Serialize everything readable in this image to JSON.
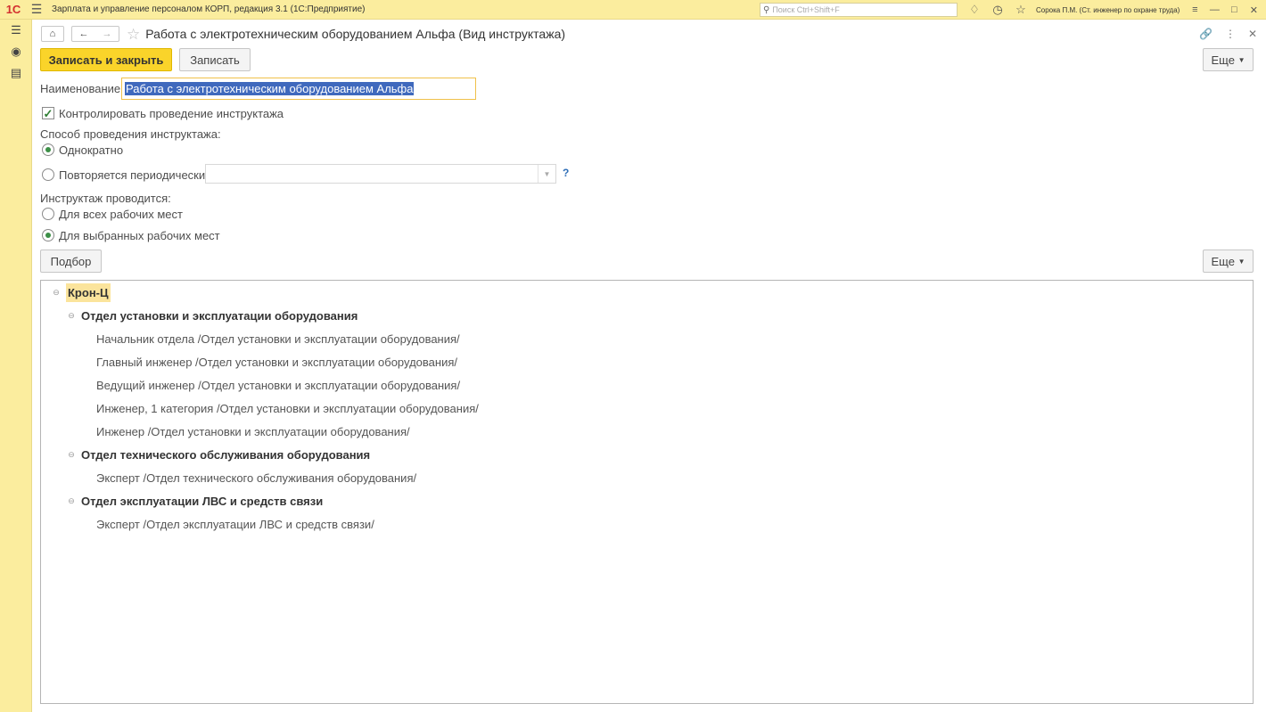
{
  "app": {
    "title": "Зарплата и управление персоналом КОРП, редакция 3.1  (1С:Предприятие)",
    "search_placeholder": "Поиск Ctrl+Shift+F",
    "user": "Сорока П.М. (Ст. инженер по охране труда)"
  },
  "form": {
    "title": "Работа с электротехническим оборудованием Альфа (Вид инструктажа)",
    "save_close_label": "Записать и закрыть",
    "save_label": "Записать",
    "more_label": "Еще",
    "name_label": "Наименование:",
    "name_value": "Работа с электротехническим оборудованием Альфа",
    "control_label": "Контролировать проведение инструктажа",
    "control_checked": true,
    "method_label": "Способ проведения инструктажа:",
    "method_once": "Однократно",
    "method_periodic": "Повторяется периодически",
    "periodic_value": "",
    "help": "?",
    "places_label": "Инструктаж проводится:",
    "places_all": "Для всех рабочих мест",
    "places_selected": "Для выбранных рабочих мест",
    "pick_label": "Подбор",
    "more_label_2": "Еще"
  },
  "tree": {
    "root": "Крон-Ц",
    "groups": [
      {
        "name": "Отдел установки и эксплуатации оборудования",
        "items": [
          "Начальник отдела /Отдел установки и эксплуатации оборудования/",
          "Главный инженер /Отдел установки и эксплуатации оборудования/",
          "Ведущий инженер /Отдел установки и эксплуатации оборудования/",
          "Инженер, 1 категория /Отдел установки и эксплуатации оборудования/",
          "Инженер /Отдел установки и эксплуатации оборудования/"
        ]
      },
      {
        "name": "Отдел технического обслуживания оборудования",
        "items": [
          "Эксперт /Отдел технического обслуживания оборудования/"
        ]
      },
      {
        "name": "Отдел эксплуатации ЛВС и средств связи",
        "items": [
          "Эксперт /Отдел эксплуатации ЛВС и средств связи/"
        ]
      }
    ]
  },
  "colors": {
    "chrome": "#fbed9e",
    "primary_button": "#fad42a",
    "selection": "#3f69bd",
    "radio_dot": "#3c8f47"
  },
  "icons": [
    "1c-logo-icon",
    "main-menu-icon",
    "search-icon",
    "bell-icon",
    "history-icon",
    "favorites-star-icon",
    "settings-menu-icon",
    "minimize-icon",
    "maximize-icon",
    "close-icon",
    "sections-icon",
    "desktop-icon",
    "news-icon",
    "home-icon",
    "back-icon",
    "forward-icon",
    "link-icon",
    "more-vert-icon",
    "tree-collapse-icon"
  ]
}
